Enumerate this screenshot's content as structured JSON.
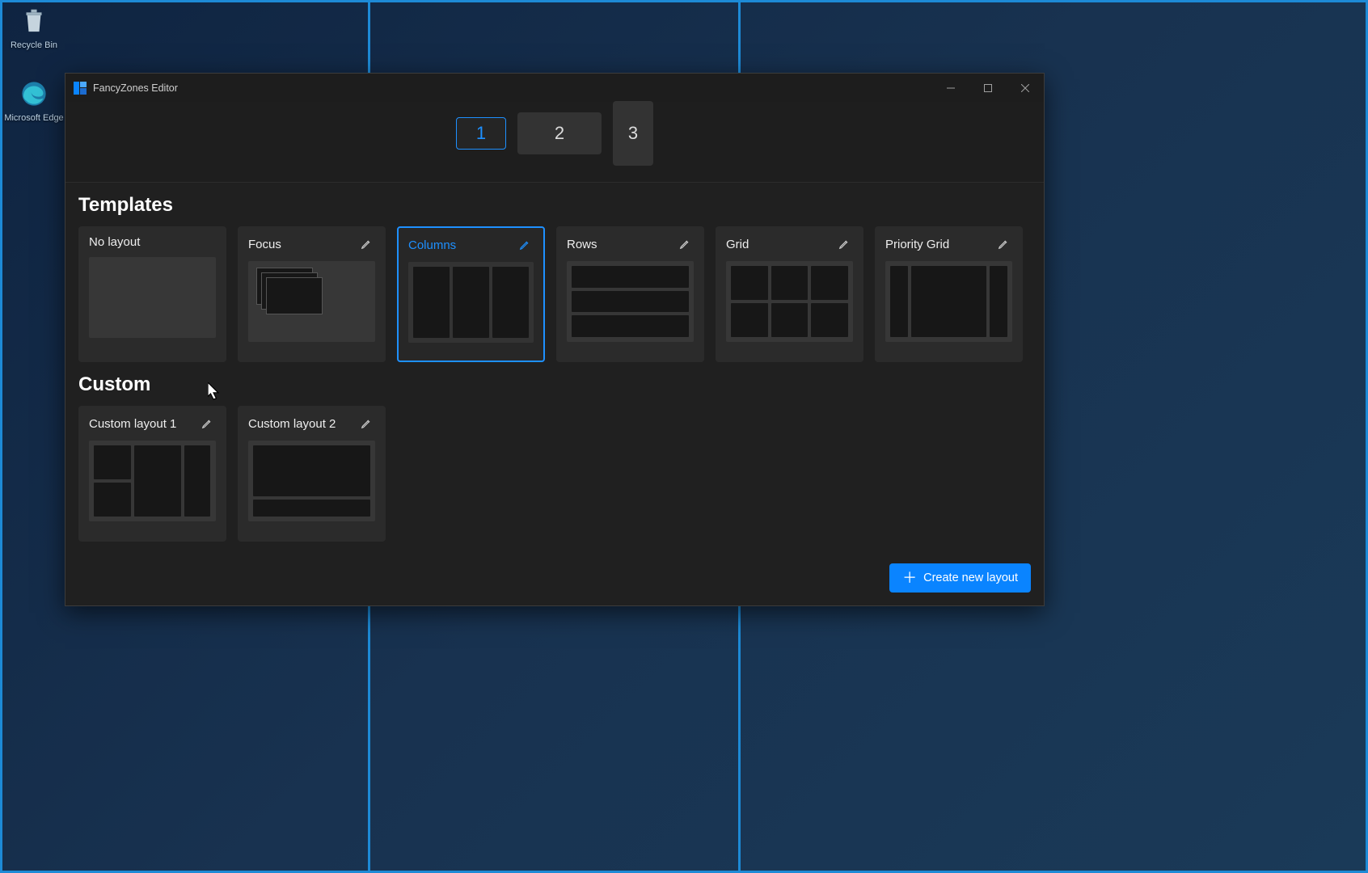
{
  "desktop": {
    "icons": {
      "recycle": "Recycle Bin",
      "edge": "Microsoft Edge"
    }
  },
  "window": {
    "title": "FancyZones Editor",
    "monitors": [
      {
        "label": "1",
        "selected": true
      },
      {
        "label": "2",
        "selected": false
      },
      {
        "label": "3",
        "selected": false
      }
    ],
    "sections": {
      "templates_title": "Templates",
      "custom_title": "Custom"
    },
    "templates": {
      "no_layout": {
        "title": "No layout"
      },
      "focus": {
        "title": "Focus"
      },
      "columns": {
        "title": "Columns",
        "selected": true
      },
      "rows": {
        "title": "Rows"
      },
      "grid": {
        "title": "Grid"
      },
      "priority_grid": {
        "title": "Priority Grid"
      }
    },
    "custom_layouts": {
      "layout1": {
        "title": "Custom layout 1"
      },
      "layout2": {
        "title": "Custom layout 2"
      }
    },
    "create_button": "Create new layout"
  }
}
